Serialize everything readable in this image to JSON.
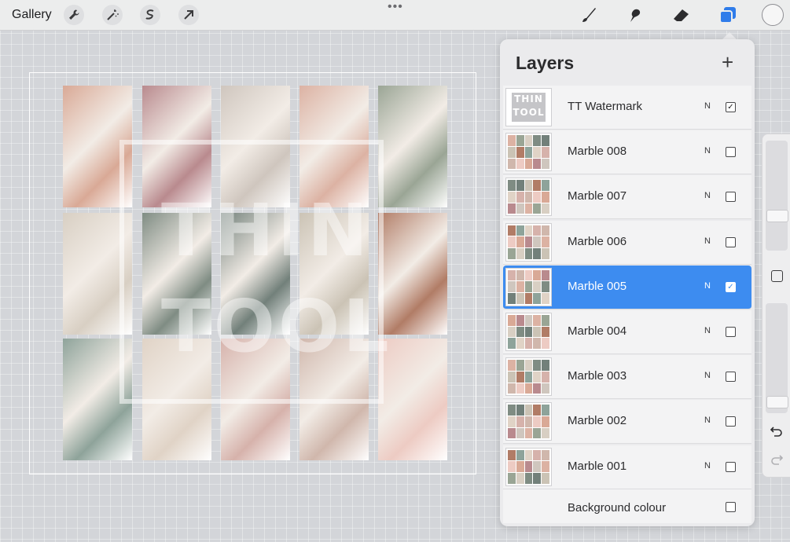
{
  "toolbar": {
    "gallery_label": "Gallery",
    "left_tools": [
      "wrench-icon",
      "magic-wand-icon",
      "selection-icon",
      "transform-arrow-icon"
    ],
    "more_label": "•••",
    "right_tools": [
      "brush-icon",
      "smudge-icon",
      "eraser-icon",
      "layers-icon"
    ],
    "current_color": "#f6f6f6"
  },
  "canvas": {
    "watermark_line1": "THIN",
    "watermark_line2": "TOOL",
    "tiles": [
      {
        "color": "#d9a996"
      },
      {
        "color": "#b98a8e"
      },
      {
        "color": "#cfc6be"
      },
      {
        "color": "#dcb2a3"
      },
      {
        "color": "#9aa595"
      },
      {
        "color": "#d8cfc3"
      },
      {
        "color": "#7f8c83"
      },
      {
        "color": "#72807a"
      },
      {
        "color": "#cbc3b5"
      },
      {
        "color": "#b17c66"
      },
      {
        "color": "#8ea39a"
      },
      {
        "color": "#e0d3c6"
      },
      {
        "color": "#d6b2ab"
      },
      {
        "color": "#d0b7ac"
      },
      {
        "color": "#edcbc3"
      }
    ]
  },
  "layers_panel": {
    "title": "Layers",
    "add_label": "+",
    "watermark_thumb_line1": "THIN",
    "watermark_thumb_line2": "TOOL",
    "layers": [
      {
        "name": "TT Watermark",
        "blend": "N",
        "checked": "✓"
      },
      {
        "name": "Marble 008",
        "blend": "N",
        "checked": ""
      },
      {
        "name": "Marble 007",
        "blend": "N",
        "checked": ""
      },
      {
        "name": "Marble 006",
        "blend": "N",
        "checked": ""
      },
      {
        "name": "Marble 005",
        "blend": "N",
        "checked": "✓"
      },
      {
        "name": "Marble 004",
        "blend": "N",
        "checked": ""
      },
      {
        "name": "Marble 003",
        "blend": "N",
        "checked": ""
      },
      {
        "name": "Marble 002",
        "blend": "N",
        "checked": ""
      },
      {
        "name": "Marble 001",
        "blend": "N",
        "checked": ""
      }
    ],
    "background_label": "Background colour",
    "selected_layer": "Marble 005",
    "accent": "#3d8cf0"
  },
  "side_controls": [
    "brush-size-slider",
    "modify-button",
    "opacity-slider",
    "undo-icon",
    "redo-icon"
  ]
}
